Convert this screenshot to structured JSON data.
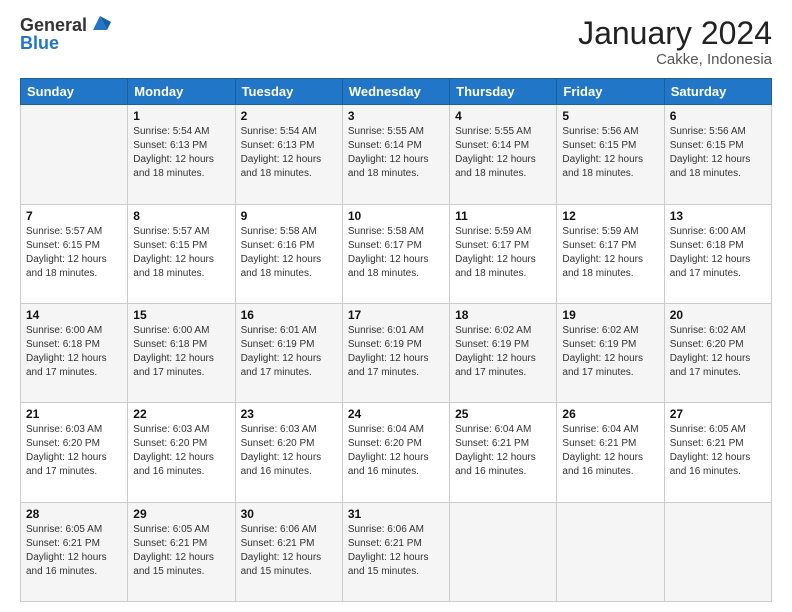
{
  "logo": {
    "general": "General",
    "blue": "Blue"
  },
  "title": "January 2024",
  "subtitle": "Cakke, Indonesia",
  "days": [
    "Sunday",
    "Monday",
    "Tuesday",
    "Wednesday",
    "Thursday",
    "Friday",
    "Saturday"
  ],
  "weeks": [
    [
      {
        "day": "",
        "sunrise": "",
        "sunset": "",
        "daylight": ""
      },
      {
        "day": "1",
        "sunrise": "Sunrise: 5:54 AM",
        "sunset": "Sunset: 6:13 PM",
        "daylight": "Daylight: 12 hours and 18 minutes."
      },
      {
        "day": "2",
        "sunrise": "Sunrise: 5:54 AM",
        "sunset": "Sunset: 6:13 PM",
        "daylight": "Daylight: 12 hours and 18 minutes."
      },
      {
        "day": "3",
        "sunrise": "Sunrise: 5:55 AM",
        "sunset": "Sunset: 6:14 PM",
        "daylight": "Daylight: 12 hours and 18 minutes."
      },
      {
        "day": "4",
        "sunrise": "Sunrise: 5:55 AM",
        "sunset": "Sunset: 6:14 PM",
        "daylight": "Daylight: 12 hours and 18 minutes."
      },
      {
        "day": "5",
        "sunrise": "Sunrise: 5:56 AM",
        "sunset": "Sunset: 6:15 PM",
        "daylight": "Daylight: 12 hours and 18 minutes."
      },
      {
        "day": "6",
        "sunrise": "Sunrise: 5:56 AM",
        "sunset": "Sunset: 6:15 PM",
        "daylight": "Daylight: 12 hours and 18 minutes."
      }
    ],
    [
      {
        "day": "7",
        "sunrise": "Sunrise: 5:57 AM",
        "sunset": "Sunset: 6:15 PM",
        "daylight": "Daylight: 12 hours and 18 minutes."
      },
      {
        "day": "8",
        "sunrise": "Sunrise: 5:57 AM",
        "sunset": "Sunset: 6:15 PM",
        "daylight": "Daylight: 12 hours and 18 minutes."
      },
      {
        "day": "9",
        "sunrise": "Sunrise: 5:58 AM",
        "sunset": "Sunset: 6:16 PM",
        "daylight": "Daylight: 12 hours and 18 minutes."
      },
      {
        "day": "10",
        "sunrise": "Sunrise: 5:58 AM",
        "sunset": "Sunset: 6:17 PM",
        "daylight": "Daylight: 12 hours and 18 minutes."
      },
      {
        "day": "11",
        "sunrise": "Sunrise: 5:59 AM",
        "sunset": "Sunset: 6:17 PM",
        "daylight": "Daylight: 12 hours and 18 minutes."
      },
      {
        "day": "12",
        "sunrise": "Sunrise: 5:59 AM",
        "sunset": "Sunset: 6:17 PM",
        "daylight": "Daylight: 12 hours and 18 minutes."
      },
      {
        "day": "13",
        "sunrise": "Sunrise: 6:00 AM",
        "sunset": "Sunset: 6:18 PM",
        "daylight": "Daylight: 12 hours and 17 minutes."
      }
    ],
    [
      {
        "day": "14",
        "sunrise": "Sunrise: 6:00 AM",
        "sunset": "Sunset: 6:18 PM",
        "daylight": "Daylight: 12 hours and 17 minutes."
      },
      {
        "day": "15",
        "sunrise": "Sunrise: 6:00 AM",
        "sunset": "Sunset: 6:18 PM",
        "daylight": "Daylight: 12 hours and 17 minutes."
      },
      {
        "day": "16",
        "sunrise": "Sunrise: 6:01 AM",
        "sunset": "Sunset: 6:19 PM",
        "daylight": "Daylight: 12 hours and 17 minutes."
      },
      {
        "day": "17",
        "sunrise": "Sunrise: 6:01 AM",
        "sunset": "Sunset: 6:19 PM",
        "daylight": "Daylight: 12 hours and 17 minutes."
      },
      {
        "day": "18",
        "sunrise": "Sunrise: 6:02 AM",
        "sunset": "Sunset: 6:19 PM",
        "daylight": "Daylight: 12 hours and 17 minutes."
      },
      {
        "day": "19",
        "sunrise": "Sunrise: 6:02 AM",
        "sunset": "Sunset: 6:19 PM",
        "daylight": "Daylight: 12 hours and 17 minutes."
      },
      {
        "day": "20",
        "sunrise": "Sunrise: 6:02 AM",
        "sunset": "Sunset: 6:20 PM",
        "daylight": "Daylight: 12 hours and 17 minutes."
      }
    ],
    [
      {
        "day": "21",
        "sunrise": "Sunrise: 6:03 AM",
        "sunset": "Sunset: 6:20 PM",
        "daylight": "Daylight: 12 hours and 17 minutes."
      },
      {
        "day": "22",
        "sunrise": "Sunrise: 6:03 AM",
        "sunset": "Sunset: 6:20 PM",
        "daylight": "Daylight: 12 hours and 16 minutes."
      },
      {
        "day": "23",
        "sunrise": "Sunrise: 6:03 AM",
        "sunset": "Sunset: 6:20 PM",
        "daylight": "Daylight: 12 hours and 16 minutes."
      },
      {
        "day": "24",
        "sunrise": "Sunrise: 6:04 AM",
        "sunset": "Sunset: 6:20 PM",
        "daylight": "Daylight: 12 hours and 16 minutes."
      },
      {
        "day": "25",
        "sunrise": "Sunrise: 6:04 AM",
        "sunset": "Sunset: 6:21 PM",
        "daylight": "Daylight: 12 hours and 16 minutes."
      },
      {
        "day": "26",
        "sunrise": "Sunrise: 6:04 AM",
        "sunset": "Sunset: 6:21 PM",
        "daylight": "Daylight: 12 hours and 16 minutes."
      },
      {
        "day": "27",
        "sunrise": "Sunrise: 6:05 AM",
        "sunset": "Sunset: 6:21 PM",
        "daylight": "Daylight: 12 hours and 16 minutes."
      }
    ],
    [
      {
        "day": "28",
        "sunrise": "Sunrise: 6:05 AM",
        "sunset": "Sunset: 6:21 PM",
        "daylight": "Daylight: 12 hours and 16 minutes."
      },
      {
        "day": "29",
        "sunrise": "Sunrise: 6:05 AM",
        "sunset": "Sunset: 6:21 PM",
        "daylight": "Daylight: 12 hours and 15 minutes."
      },
      {
        "day": "30",
        "sunrise": "Sunrise: 6:06 AM",
        "sunset": "Sunset: 6:21 PM",
        "daylight": "Daylight: 12 hours and 15 minutes."
      },
      {
        "day": "31",
        "sunrise": "Sunrise: 6:06 AM",
        "sunset": "Sunset: 6:21 PM",
        "daylight": "Daylight: 12 hours and 15 minutes."
      },
      {
        "day": "",
        "sunrise": "",
        "sunset": "",
        "daylight": ""
      },
      {
        "day": "",
        "sunrise": "",
        "sunset": "",
        "daylight": ""
      },
      {
        "day": "",
        "sunrise": "",
        "sunset": "",
        "daylight": ""
      }
    ]
  ]
}
